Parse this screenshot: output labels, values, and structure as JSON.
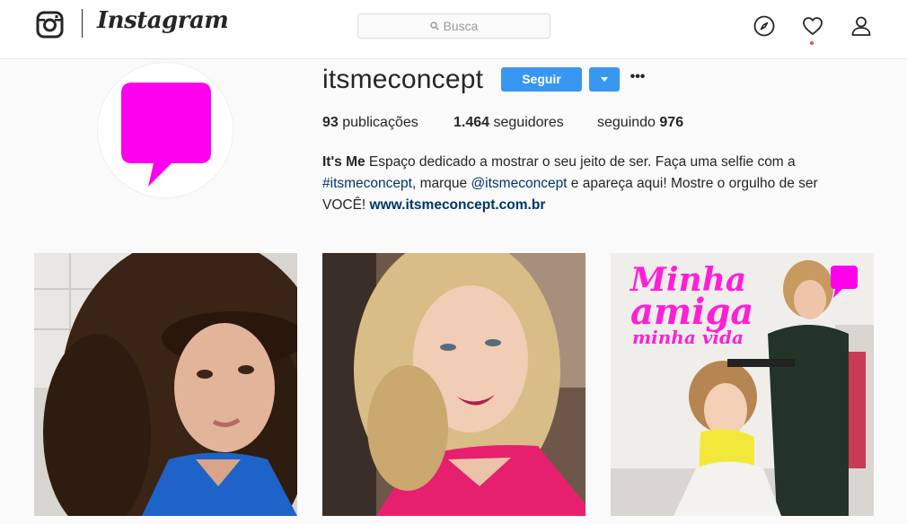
{
  "header": {
    "wordmark": "Instagram",
    "search_placeholder": "Busca",
    "icons": [
      "instagram-glyph-icon",
      "compass-icon",
      "heart-icon",
      "user-icon"
    ]
  },
  "profile": {
    "username": "itsmeconcept",
    "follow_label": "Seguir",
    "more_label": "•••",
    "stats": {
      "posts_count": "93",
      "posts_label": "publicações",
      "followers_count": "1.464",
      "followers_label": "seguidores",
      "following_label": "seguindo",
      "following_count": "976"
    },
    "bio": {
      "name": "It's Me",
      "text1": " Espaço dedicado a mostrar o seu jeito de ser. Faça uma selfie com a ",
      "hashtag": "#itsmeconcept",
      "text2": ", marque ",
      "mention": "@itsmeconcept",
      "text3": " e apareça aqui! Mostre o orgulho de ser VOCÊ! ",
      "website": "www.itsmeconcept.com.br"
    }
  },
  "posts": [
    {
      "overlay": null
    },
    {
      "overlay": null
    },
    {
      "overlay": {
        "line1": "Minha",
        "line2": "amiga",
        "line3": "minha vida"
      }
    }
  ],
  "colors": {
    "accent": "#3897f0",
    "brand_magenta": "#ff00ee",
    "link": "#003569",
    "notification": "#ed4956"
  }
}
